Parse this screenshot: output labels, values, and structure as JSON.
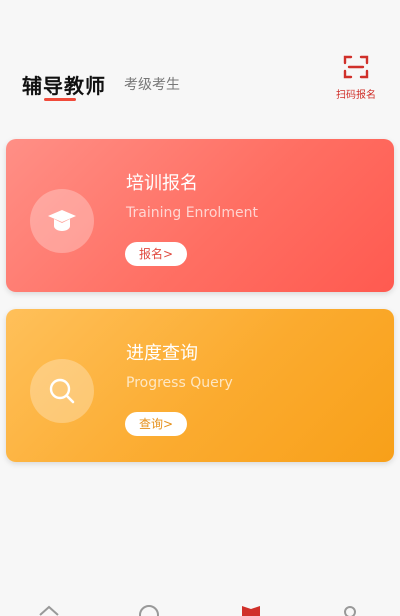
{
  "header": {
    "tab_active": "辅导教师",
    "tab_inactive": "考级考生",
    "scan_label": "扫码报名"
  },
  "cards": [
    {
      "title": "培训报名",
      "subtitle": "Training Enrolment",
      "button": "报名>",
      "icon": "graduation-cap-icon"
    },
    {
      "title": "进度查询",
      "subtitle": "Progress Query",
      "button": "查询>",
      "icon": "search-icon"
    }
  ],
  "bottom_nav": {
    "icons": [
      "home-icon",
      "compass-icon",
      "book-icon",
      "user-icon"
    ],
    "active_color": "#d0302a"
  },
  "colors": {
    "accent": "#f04a3a",
    "card_train": "#ff6f63",
    "card_query": "#fbab2f"
  }
}
